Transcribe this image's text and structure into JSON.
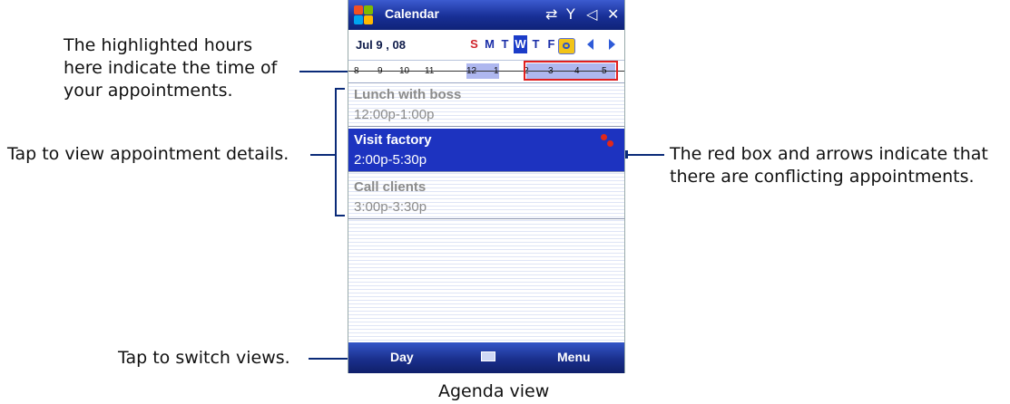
{
  "phone": {
    "title": "Calendar",
    "date": "Jul  9 , 08",
    "days": [
      "S",
      "M",
      "T",
      "W",
      "T",
      "F",
      "S"
    ],
    "selected_day_index": 3,
    "hours": [
      "8",
      "9",
      "10",
      "11",
      "12",
      "1",
      "2",
      "3",
      "4",
      "5"
    ],
    "appointments": [
      {
        "title": "Lunch with boss",
        "time": "12:00p-1:00p"
      },
      {
        "title": "Visit factory",
        "time": "2:00p-5:30p"
      },
      {
        "title": "Call clients",
        "time": "3:00p-3:30p"
      }
    ],
    "softkeys": {
      "left": "Day",
      "right": "Menu"
    },
    "icons": [
      "windows-start-icon",
      "connectivity-icon",
      "signal-icon",
      "volume-icon",
      "close-icon",
      "today-icon",
      "prev-arrow-icon",
      "next-arrow-icon",
      "keyboard-icon"
    ]
  },
  "annotations": {
    "highlighted_hours": [
      "The highlighted hours",
      "here indicate the time of",
      "your appointments."
    ],
    "tap_details": "Tap to view appointment details.",
    "conflict": [
      "The red box and arrows indicate that",
      "there are conflicting appointments."
    ],
    "switch_views": "Tap to switch views."
  },
  "caption": "Agenda view",
  "colors": {
    "accent": "#1d33c0",
    "annotation_line": "#0a2a78",
    "conflict": "#e01f1f"
  }
}
